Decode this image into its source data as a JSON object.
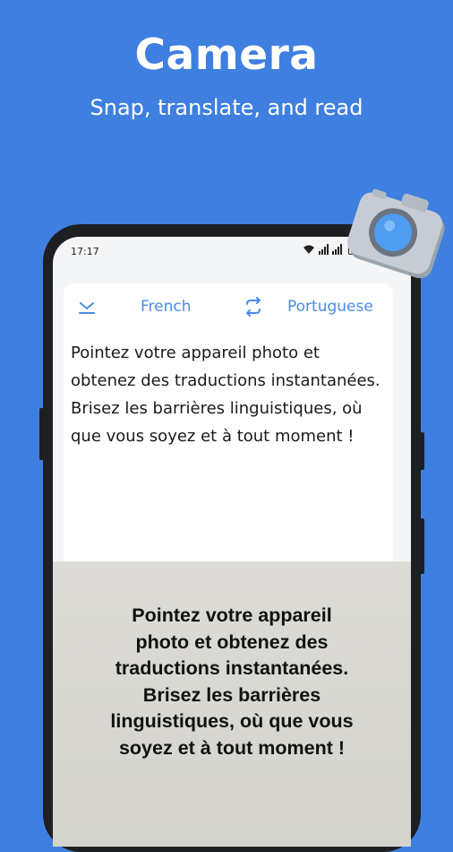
{
  "promo": {
    "title": "Camera",
    "subtitle": "Snap, translate, and read"
  },
  "status_bar": {
    "time": "17:17",
    "icons": [
      "wifi-icon",
      "signal-icon",
      "battery-icon"
    ]
  },
  "translator": {
    "collapse_icon": "chevron-down-icon",
    "source_language": "French",
    "swap_icon": "swap-icon",
    "target_language": "Portuguese",
    "source_text": "Pointez votre appareil photo et obtenez des traductions instantanées. Brisez les barrières linguistiques, où que vous soyez et à tout moment !"
  },
  "camera_view": {
    "captured_text_lines": [
      "Pointez votre appareil",
      "photo et obtenez des",
      "traductions instantanées.",
      "Brisez les barrières",
      "linguistiques, où que vous",
      "soyez et à tout moment !"
    ]
  },
  "decoration": {
    "camera_icon": "camera-icon"
  },
  "colors": {
    "background": "#3f7fe0",
    "accent": "#4a8ce6",
    "phone_frame": "#1d1f22"
  }
}
